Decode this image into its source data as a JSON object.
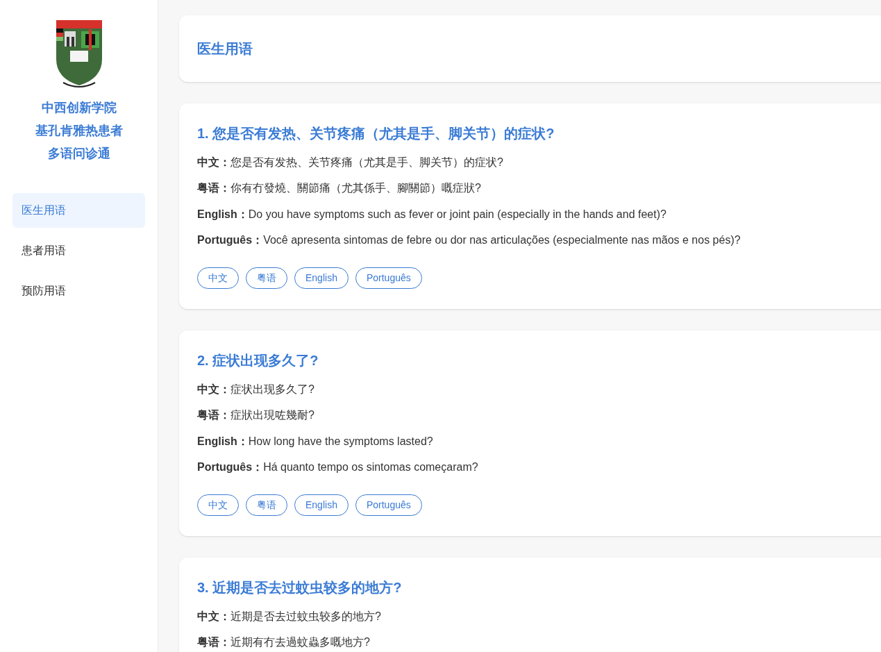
{
  "sidebar": {
    "title_lines": [
      "中西创新学院",
      "基孔肯雅热患者",
      "多语问诊通"
    ],
    "items": [
      {
        "label": "医生用语",
        "selected": true
      },
      {
        "label": "患者用语",
        "selected": false
      },
      {
        "label": "预防用语",
        "selected": false
      }
    ]
  },
  "header": {
    "title": "医生用语"
  },
  "questions": [
    {
      "title": "1. 您是否有发热、关节疼痛（尤其是手、脚关节）的症状?",
      "lines": [
        "**中文：**您是否有发热、关节疼痛（尤其是手、脚关节）的症状?",
        "**粤语：**你有冇發燒、關節痛（尤其係手、腳關節）嘅症狀?",
        "**English：**Do you have symptoms such as fever or joint pain (especially in the hands and feet)?",
        "**Português：**Você apresenta sintomas de febre ou dor nas articulações (especialmente nas mãos e nos pés)?"
      ],
      "buttons": [
        "中文",
        "粤语",
        "English",
        "Português"
      ]
    },
    {
      "title": "2. 症状出现多久了?",
      "lines": [
        "**中文：**症状出现多久了?",
        "**粤语：**症狀出現咗幾耐?",
        "**English：**How long have the symptoms lasted?",
        "**Português：**Há quanto tempo os sintomas começaram?"
      ],
      "buttons": [
        "中文",
        "粤语",
        "English",
        "Português"
      ]
    },
    {
      "title": "3. 近期是否去过蚊虫较多的地方?",
      "lines": [
        "**中文：**近期是否去过蚊虫较多的地方?",
        "**粤语：**近期有冇去過蚊蟲多嘅地方?"
      ]
    }
  ]
}
